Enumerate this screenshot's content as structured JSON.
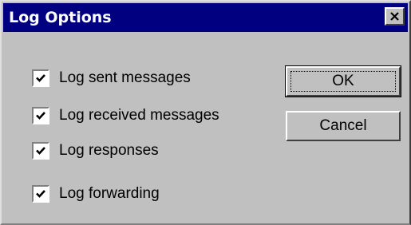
{
  "window": {
    "title": "Log Options"
  },
  "options": [
    {
      "label": "Log sent messages",
      "checked": true
    },
    {
      "label": "Log received messages",
      "checked": true
    },
    {
      "label": "Log responses",
      "checked": true
    },
    {
      "label": "Log forwarding",
      "checked": true
    }
  ],
  "buttons": {
    "ok_label": "OK",
    "cancel_label": "Cancel"
  },
  "colors": {
    "titlebar": "#000080",
    "face": "#c0c0c0"
  },
  "icons": {
    "close": "close-icon",
    "check": "checkmark-icon"
  }
}
